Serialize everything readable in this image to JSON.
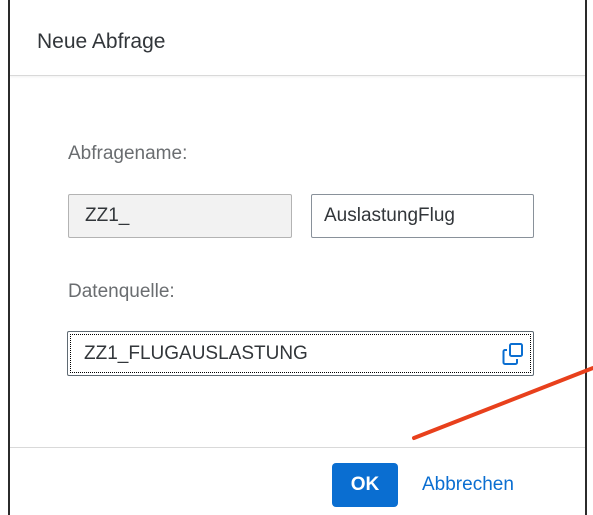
{
  "dialog": {
    "title": "Neue Abfrage"
  },
  "form": {
    "query_name_label": "Abfragename:",
    "query_name_prefix": "ZZ1_",
    "query_name_value": "AuslastungFlug",
    "data_source_label": "Datenquelle:",
    "data_source_value": "ZZ1_FLUGAUSLASTUNG",
    "data_source_icon": "value-help-icon"
  },
  "footer": {
    "ok_label": "OK",
    "cancel_label": "Abbrechen"
  },
  "colors": {
    "accent": "#0a6ed1",
    "annotation_arrow": "#e8401c",
    "text": "#32363a",
    "label": "#6a6d70"
  }
}
